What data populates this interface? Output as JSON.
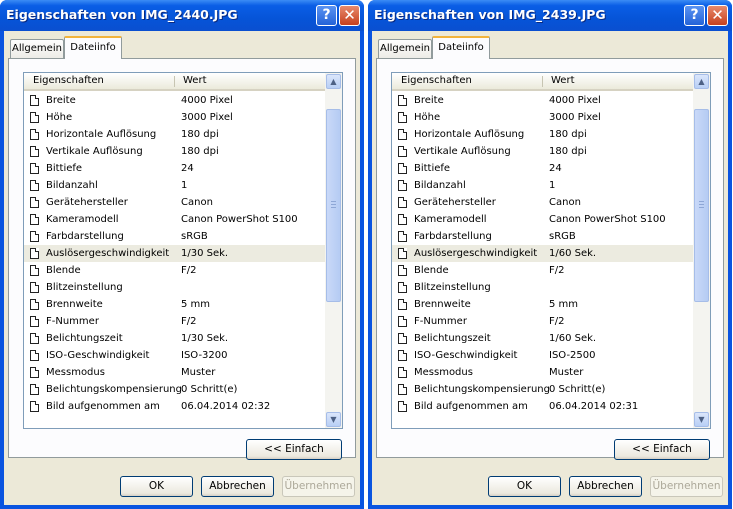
{
  "windows": [
    {
      "title": "Eigenschaften von IMG_2440.JPG",
      "tabs": [
        "Allgemein",
        "Dateiinfo"
      ],
      "columns": [
        "Eigenschaften",
        "Wert"
      ],
      "selected_row": 9,
      "rows": [
        {
          "name": "Breite",
          "value": "4000 Pixel"
        },
        {
          "name": "Höhe",
          "value": "3000 Pixel"
        },
        {
          "name": "Horizontale Auflösung",
          "value": "180 dpi"
        },
        {
          "name": "Vertikale Auflösung",
          "value": "180 dpi"
        },
        {
          "name": "Bittiefe",
          "value": "24"
        },
        {
          "name": "Bildanzahl",
          "value": "1"
        },
        {
          "name": "Gerätehersteller",
          "value": "Canon"
        },
        {
          "name": "Kameramodell",
          "value": "Canon PowerShot S100"
        },
        {
          "name": "Farbdarstellung",
          "value": "sRGB"
        },
        {
          "name": "Auslösergeschwindigkeit",
          "value": "1/30 Sek."
        },
        {
          "name": "Blende",
          "value": "F/2"
        },
        {
          "name": "Blitzeinstellung",
          "value": ""
        },
        {
          "name": "Brennweite",
          "value": "5 mm"
        },
        {
          "name": "F-Nummer",
          "value": "F/2"
        },
        {
          "name": "Belichtungszeit",
          "value": "1/30 Sek."
        },
        {
          "name": "ISO-Geschwindigkeit",
          "value": "ISO-3200"
        },
        {
          "name": "Messmodus",
          "value": "Muster"
        },
        {
          "name": "Belichtungskompensierung",
          "value": "0 Schritt(e)"
        },
        {
          "name": "Bild aufgenommen am",
          "value": "06.04.2014 02:32"
        }
      ],
      "simple_button": "<< Einfach",
      "ok": "OK",
      "cancel": "Abbrechen",
      "apply": "Übernehmen"
    },
    {
      "title": "Eigenschaften von IMG_2439.JPG",
      "tabs": [
        "Allgemein",
        "Dateiinfo"
      ],
      "columns": [
        "Eigenschaften",
        "Wert"
      ],
      "selected_row": 9,
      "rows": [
        {
          "name": "Breite",
          "value": "4000 Pixel"
        },
        {
          "name": "Höhe",
          "value": "3000 Pixel"
        },
        {
          "name": "Horizontale Auflösung",
          "value": "180 dpi"
        },
        {
          "name": "Vertikale Auflösung",
          "value": "180 dpi"
        },
        {
          "name": "Bittiefe",
          "value": "24"
        },
        {
          "name": "Bildanzahl",
          "value": "1"
        },
        {
          "name": "Gerätehersteller",
          "value": "Canon"
        },
        {
          "name": "Kameramodell",
          "value": "Canon PowerShot S100"
        },
        {
          "name": "Farbdarstellung",
          "value": "sRGB"
        },
        {
          "name": "Auslösergeschwindigkeit",
          "value": "1/60 Sek."
        },
        {
          "name": "Blende",
          "value": "F/2"
        },
        {
          "name": "Blitzeinstellung",
          "value": ""
        },
        {
          "name": "Brennweite",
          "value": "5 mm"
        },
        {
          "name": "F-Nummer",
          "value": "F/2"
        },
        {
          "name": "Belichtungszeit",
          "value": "1/60 Sek."
        },
        {
          "name": "ISO-Geschwindigkeit",
          "value": "ISO-2500"
        },
        {
          "name": "Messmodus",
          "value": "Muster"
        },
        {
          "name": "Belichtungskompensierung",
          "value": "0 Schritt(e)"
        },
        {
          "name": "Bild aufgenommen am",
          "value": "06.04.2014 02:31"
        }
      ],
      "simple_button": "<< Einfach",
      "ok": "OK",
      "cancel": "Abbrechen",
      "apply": "Übernehmen"
    }
  ],
  "icons": {
    "help": "help-icon",
    "close": "close-icon",
    "scroll_up": "scroll-up-icon",
    "scroll_down": "scroll-down-icon",
    "row": "document-icon"
  },
  "colors": {
    "titlebar": "#0a54e0",
    "dialog": "#ece9d8",
    "selected_row": "#ecebe0"
  }
}
